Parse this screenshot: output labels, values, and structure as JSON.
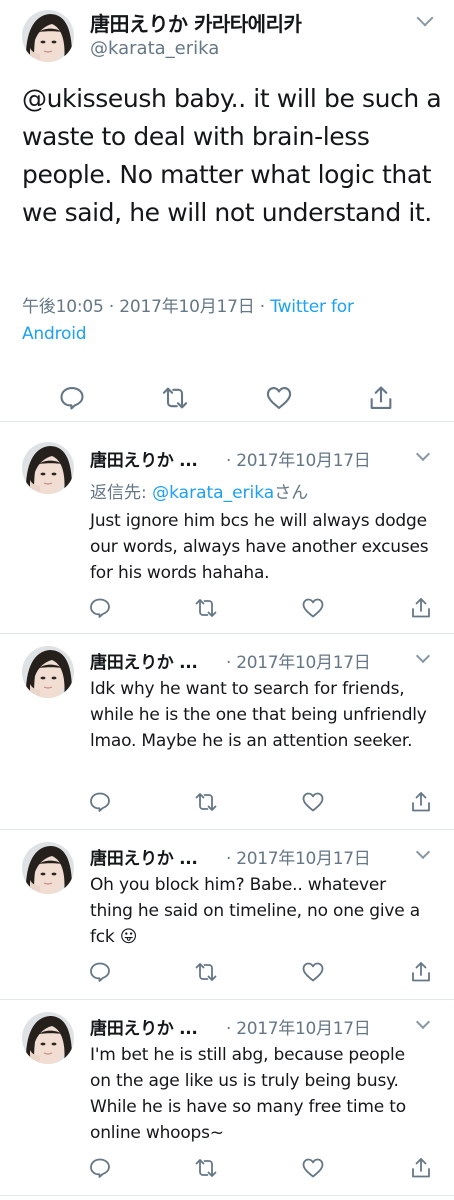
{
  "main_tweet": {
    "display_name": "唐田えりか 카라타에리카",
    "handle": "@karata_erika",
    "text": "@ukisseush baby.. it will be such a waste to deal with brain-less people. No matter what logic that we said, he will not understand it.",
    "time": "午後10:05",
    "separator": "·",
    "date": "2017年10月17日",
    "source": "Twitter for Android",
    "actions": [
      "reply-icon",
      "retweet-icon",
      "like-icon",
      "share-icon"
    ]
  },
  "replies": [
    {
      "display_name": "唐田えりか ...",
      "date": "· 2017年10月17日",
      "reply_to_label": "返信先: ",
      "reply_to_handle": "@karata_erika",
      "reply_to_suffix": "さん",
      "text": "Just ignore him bcs he will always dodge our words, always have another excuses for his words hahaha."
    },
    {
      "display_name": "唐田えりか ...",
      "date": "· 2017年10月17日",
      "text": "Idk why he want to search for friends, while he is the one that being unfriendly lmao. Maybe he is an attention seeker."
    },
    {
      "display_name": "唐田えりか ...",
      "date": "· 2017年10月17日",
      "text": "Oh you block him? Babe.. whatever thing he said on timeline, no one give a fck",
      "emoji": "😛"
    },
    {
      "display_name": "唐田えりか ...",
      "date": "· 2017年10月17日",
      "text": "I'm bet he is still abg, because people on the age like us is truly being busy. While he is have so many free time to online whoops~"
    }
  ],
  "colors": {
    "link": "#1da1f2",
    "secondary_text": "#657786",
    "icon": "#657786",
    "divider": "#e1e8ed",
    "text": "#14171a"
  }
}
